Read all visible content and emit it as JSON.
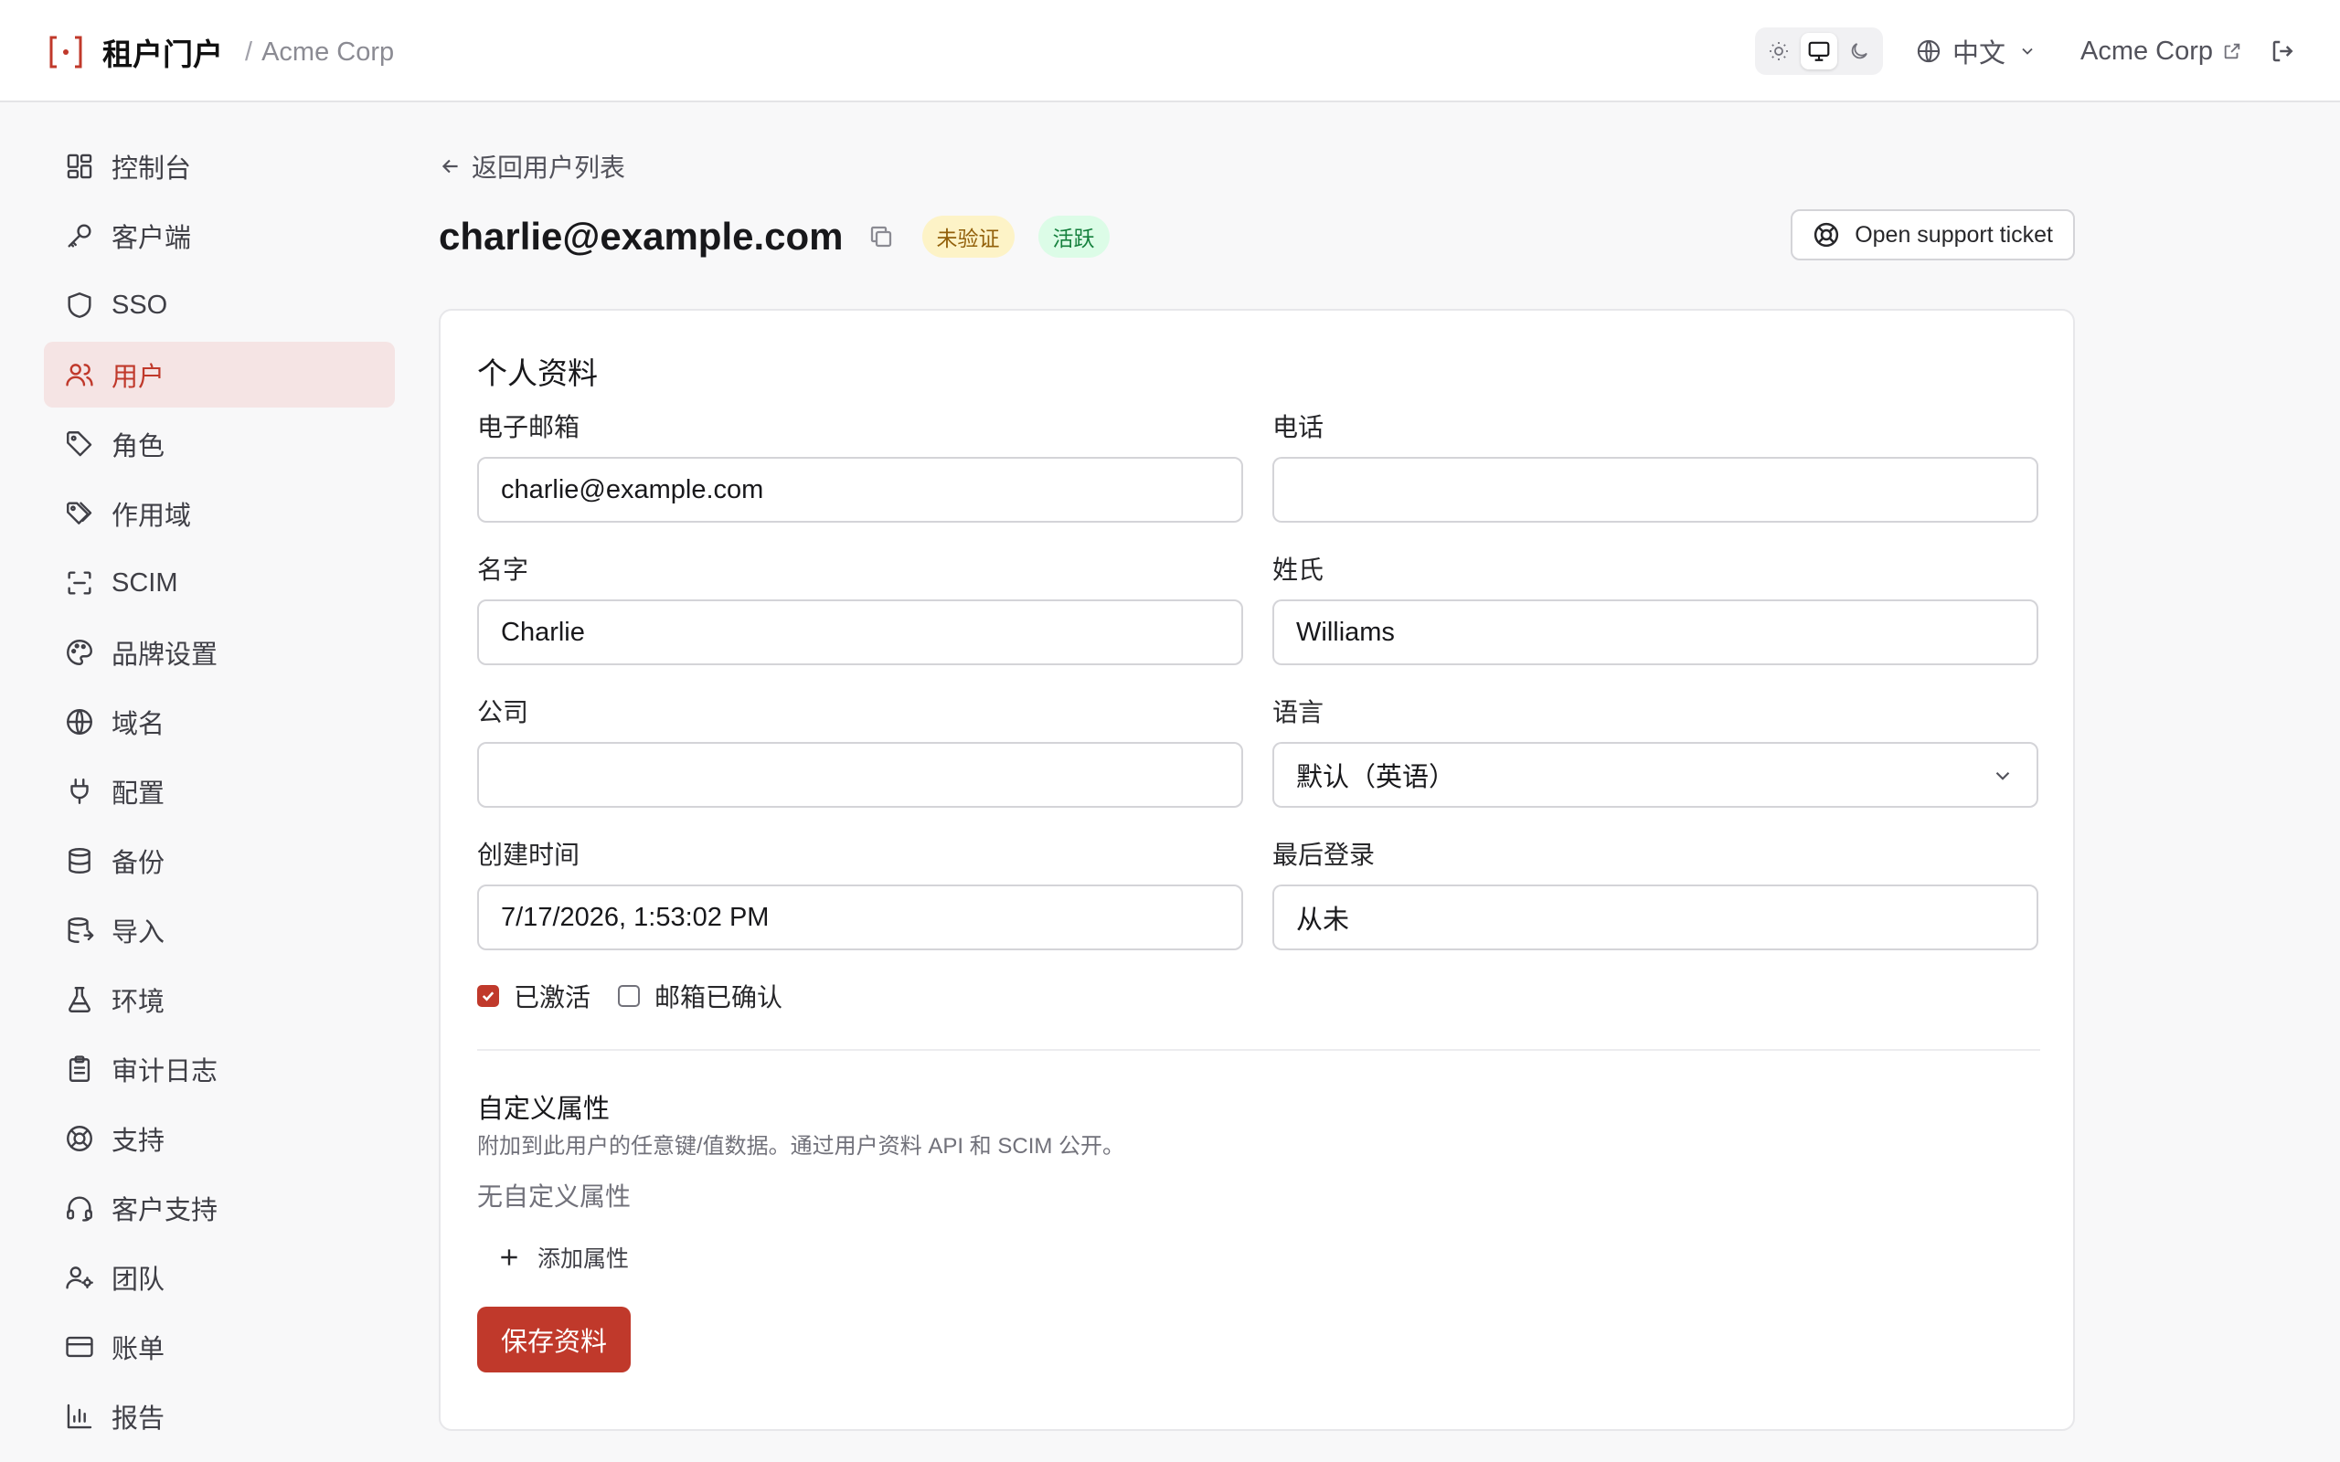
{
  "header": {
    "app_title": "租户门户",
    "separator": "/",
    "tenant_name": "Acme Corp",
    "language": "中文",
    "tenant_link": "Acme Corp",
    "theme_modes": [
      "light-icon",
      "monitor-icon",
      "moon-icon"
    ],
    "active_theme": "monitor"
  },
  "sidebar": {
    "items": [
      {
        "label": "控制台",
        "icon": "dashboard-icon"
      },
      {
        "label": "客户端",
        "icon": "key-icon"
      },
      {
        "label": "SSO",
        "icon": "shield-icon"
      },
      {
        "label": "用户",
        "icon": "users-icon",
        "active": true
      },
      {
        "label": "角色",
        "icon": "tag-icon"
      },
      {
        "label": "作用域",
        "icon": "tags-icon"
      },
      {
        "label": "SCIM",
        "icon": "scan-icon"
      },
      {
        "label": "品牌设置",
        "icon": "palette-icon"
      },
      {
        "label": "域名",
        "icon": "globe-icon"
      },
      {
        "label": "配置",
        "icon": "plug-icon"
      },
      {
        "label": "备份",
        "icon": "database-icon"
      },
      {
        "label": "导入",
        "icon": "database-import-icon"
      },
      {
        "label": "环境",
        "icon": "flask-icon"
      },
      {
        "label": "审计日志",
        "icon": "clipboard-icon"
      },
      {
        "label": "支持",
        "icon": "lifebuoy-icon"
      },
      {
        "label": "客户支持",
        "icon": "headset-icon"
      },
      {
        "label": "团队",
        "icon": "team-icon"
      },
      {
        "label": "账单",
        "icon": "card-icon"
      },
      {
        "label": "报告",
        "icon": "bar-chart-icon"
      }
    ]
  },
  "main": {
    "back_label": "返回用户列表",
    "title": "charlie@example.com",
    "badge_unverified": "未验证",
    "badge_active": "活跃",
    "support_button": "Open support ticket"
  },
  "profile": {
    "section_title": "个人资料",
    "email_label": "电子邮箱",
    "email_value": "charlie@example.com",
    "phone_label": "电话",
    "phone_value": "",
    "first_name_label": "名字",
    "first_name_value": "Charlie",
    "last_name_label": "姓氏",
    "last_name_value": "Williams",
    "company_label": "公司",
    "company_value": "",
    "language_label": "语言",
    "language_value": "默认（英语）",
    "created_label": "创建时间",
    "created_value": "7/17/2026, 1:53:02 PM",
    "last_login_label": "最后登录",
    "last_login_value": "从未",
    "activated_label": "已激活",
    "activated_checked": true,
    "email_confirmed_label": "邮箱已确认",
    "email_confirmed_checked": false,
    "custom_title": "自定义属性",
    "custom_desc": "附加到此用户的任意键/值数据。通过用户资料 API 和 SCIM 公开。",
    "custom_empty": "无自定义属性",
    "add_attr_label": "添加属性",
    "save_label": "保存资料"
  },
  "colors": {
    "accent": "#c0392b",
    "active_nav_bg": "#f5e4e4",
    "badge_warn_bg": "#fdf3c7",
    "badge_ok_bg": "#dcfce7"
  }
}
